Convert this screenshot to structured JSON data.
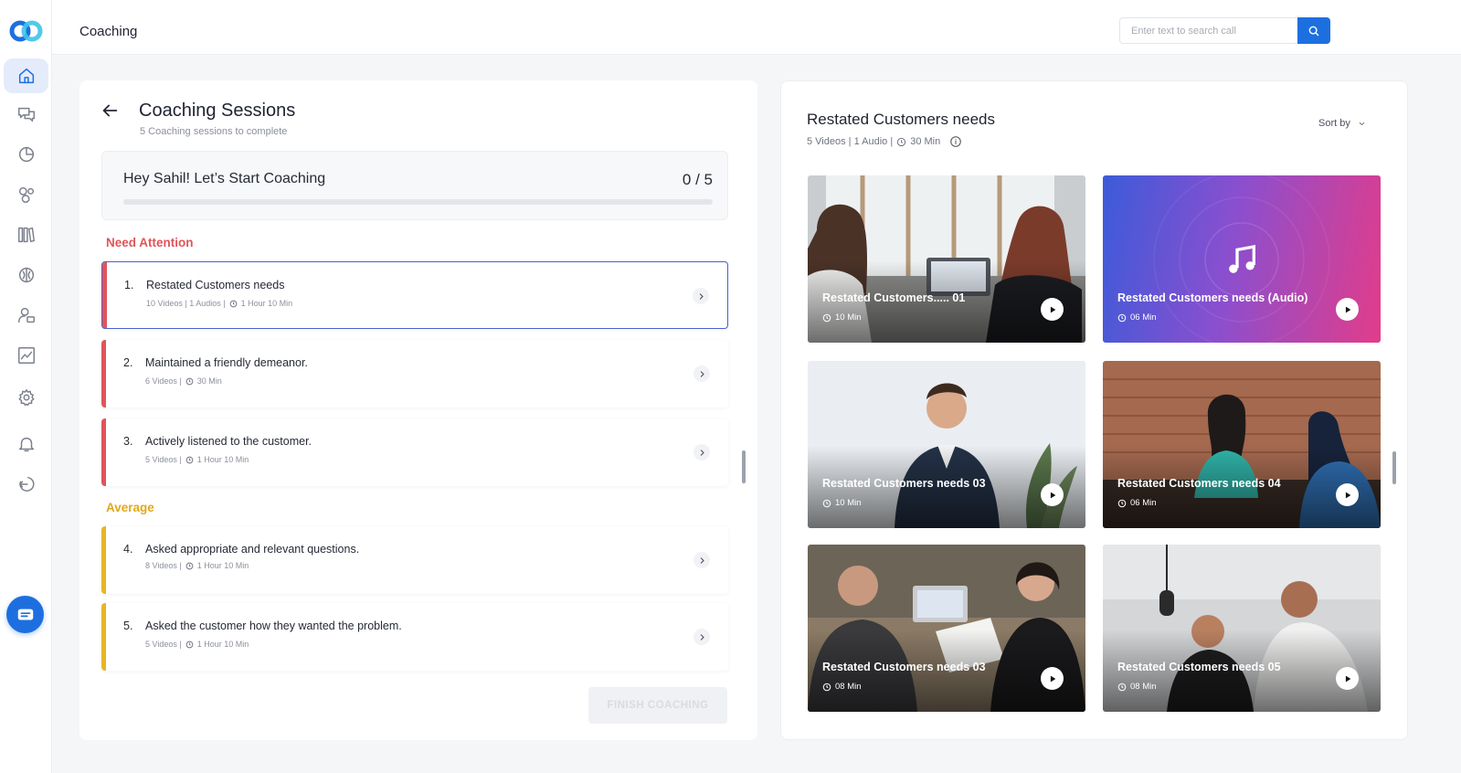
{
  "header": {
    "title": "Coaching",
    "search_placeholder": "Enter text to search call"
  },
  "sidebar": {
    "items": [
      {
        "icon": "home-icon",
        "active": true
      },
      {
        "icon": "chat-icon"
      },
      {
        "icon": "pie-chart-icon"
      },
      {
        "icon": "bubbles-icon"
      },
      {
        "icon": "library-icon"
      },
      {
        "icon": "brain-icon"
      },
      {
        "icon": "user-settings-icon"
      },
      {
        "icon": "trend-chart-icon"
      },
      {
        "icon": "gear-icon"
      },
      {
        "icon": "bell-icon"
      },
      {
        "icon": "logout-icon"
      }
    ],
    "fab_icon": "chat-support-icon"
  },
  "coaching": {
    "title": "Coaching Sessions",
    "subtitle": "5 Coaching sessions to complete",
    "greeting": "Hey Sahil! Let’s Start Coaching",
    "progress_text": "0 / 5",
    "progress_fraction": 0,
    "need_attention_label": "Need Attention",
    "average_label": "Average",
    "sessions": [
      {
        "num": "1.",
        "title": "Restated Customers needs",
        "meta": "10 Videos | 1 Audios |",
        "duration": "1 Hour 10 Min",
        "group": "attention",
        "selected": true
      },
      {
        "num": "2.",
        "title": "Maintained a friendly demeanor.",
        "meta": "6 Videos |",
        "duration": "30 Min",
        "group": "attention"
      },
      {
        "num": "3.",
        "title": "Actively listened to the customer.",
        "meta": "5 Videos |",
        "duration": "1 Hour 10 Min",
        "group": "attention"
      },
      {
        "num": "4.",
        "title": "Asked appropriate and relevant questions.",
        "meta": "8 Videos |",
        "duration": "1 Hour 10 Min",
        "group": "average"
      },
      {
        "num": "5.",
        "title": "Asked the customer how they wanted the problem.",
        "meta": "5 Videos |",
        "duration": "1 Hour 10 Min",
        "group": "average"
      }
    ],
    "finish_label": "FINISH COACHING"
  },
  "detail": {
    "title": "Restated Customers needs",
    "meta": "5 Videos | 1 Audio |",
    "duration": "30 Min",
    "sort_label": "Sort by",
    "cards": [
      {
        "title": "Restated Customers..... 01",
        "duration": "10 Min",
        "kind": "video"
      },
      {
        "title": "Restated Customers needs (Audio)",
        "duration": "06 Min",
        "kind": "audio"
      },
      {
        "title": "Restated Customers needs 03",
        "duration": "10 Min",
        "kind": "video"
      },
      {
        "title": "Restated Customers needs 04",
        "duration": "06 Min",
        "kind": "video"
      },
      {
        "title": "Restated Customers needs 03",
        "duration": "08 Min",
        "kind": "video"
      },
      {
        "title": "Restated Customers needs 05",
        "duration": "08 Min",
        "kind": "video"
      }
    ]
  },
  "colors": {
    "accent": "#1d6fe0",
    "need_attention": "#e0545a",
    "average": "#e9b524"
  }
}
